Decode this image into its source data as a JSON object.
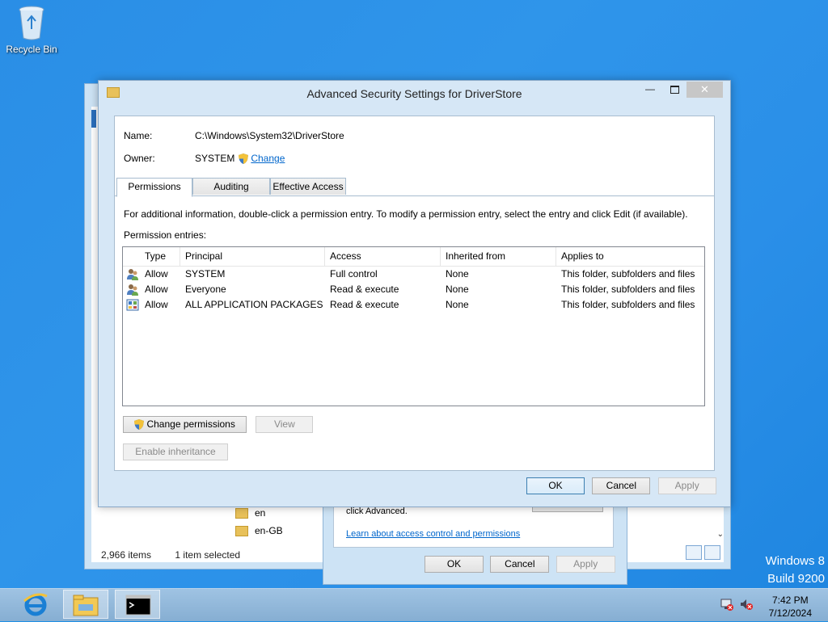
{
  "desktop": {
    "recycle_bin_label": "Recycle Bin",
    "watermark_line1": "Windows 8",
    "watermark_line2": "Build 9200"
  },
  "explorer": {
    "status_items": "2,966 items",
    "status_selected": "1 item selected",
    "folders": [
      "en",
      "en-GB"
    ]
  },
  "properties": {
    "advanced_text": "click Advanced.",
    "learn_link": "Learn about access control and permissions",
    "ok_label": "OK",
    "cancel_label": "Cancel",
    "apply_label": "Apply"
  },
  "dialog": {
    "title": "Advanced Security Settings for DriverStore",
    "name_label": "Name:",
    "name_value": "C:\\Windows\\System32\\DriverStore",
    "owner_label": "Owner:",
    "owner_value": "SYSTEM",
    "owner_change_link": "Change",
    "tabs": [
      {
        "label": "Permissions"
      },
      {
        "label": "Auditing"
      },
      {
        "label": "Effective Access"
      }
    ],
    "info_text": "For additional information, double-click a permission entry. To modify a permission entry, select the entry and click Edit (if available).",
    "entries_label": "Permission entries:",
    "columns": [
      "Type",
      "Principal",
      "Access",
      "Inherited from",
      "Applies to"
    ],
    "rows": [
      {
        "icon": "users-icon",
        "type": "Allow",
        "principal": "SYSTEM",
        "access": "Full control",
        "inherited": "None",
        "applies": "This folder, subfolders and files"
      },
      {
        "icon": "users-icon",
        "type": "Allow",
        "principal": "Everyone",
        "access": "Read & execute",
        "inherited": "None",
        "applies": "This folder, subfolders and files"
      },
      {
        "icon": "app-packages-icon",
        "type": "Allow",
        "principal": "ALL APPLICATION PACKAGES",
        "access": "Read & execute",
        "inherited": "None",
        "applies": "This folder, subfolders and files"
      }
    ],
    "change_permissions_label": "Change permissions",
    "view_label": "View",
    "enable_inheritance_label": "Enable inheritance",
    "ok_label": "OK",
    "cancel_label": "Cancel",
    "apply_label": "Apply"
  },
  "taskbar": {
    "time": "7:42 PM",
    "date": "7/12/2024"
  },
  "colors": {
    "desktop": "#2a8ee6",
    "dialog_frame": "#d6e7f6",
    "link": "#0066cc"
  }
}
